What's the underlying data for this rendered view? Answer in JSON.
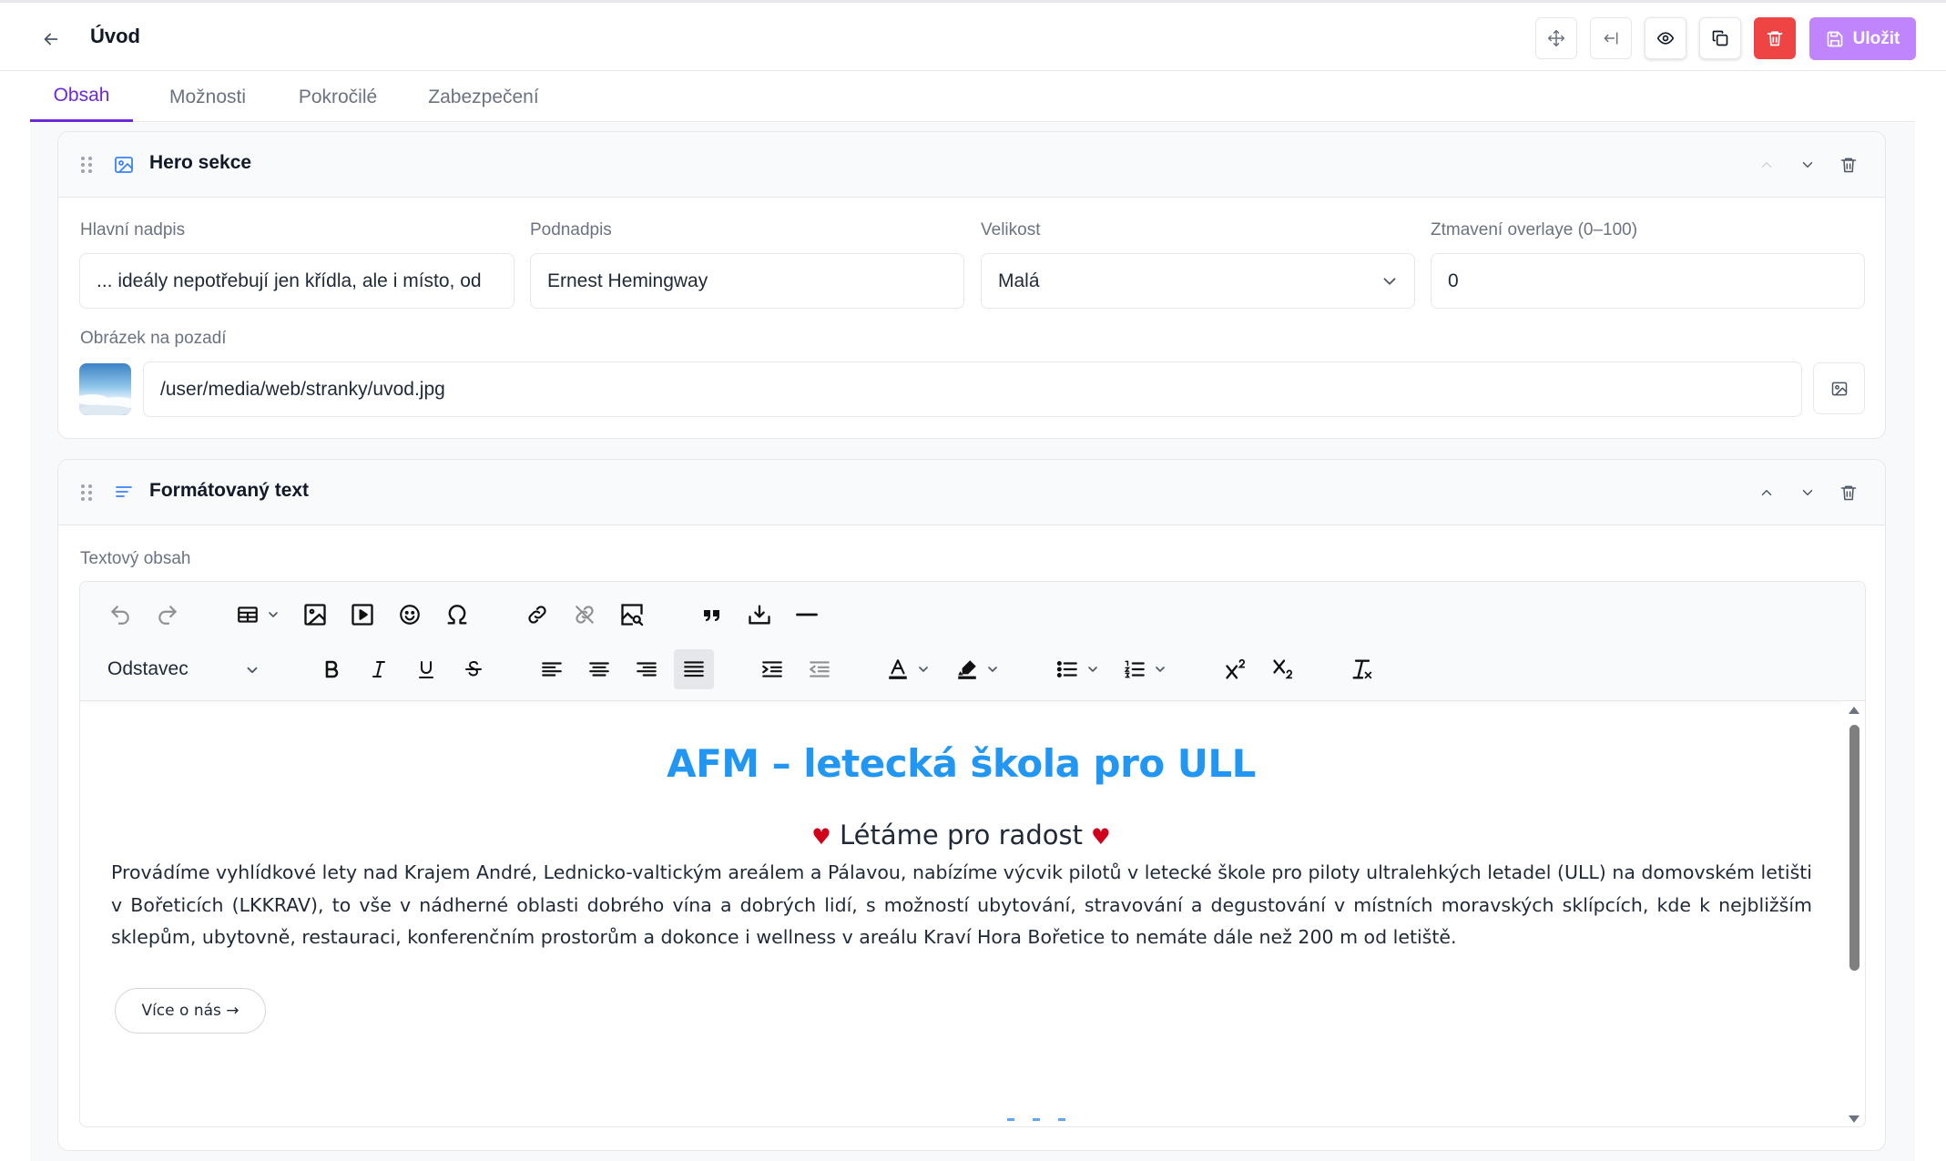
{
  "header": {
    "title": "Úvod",
    "save_label": "Uložit",
    "actions": [
      "move-icon",
      "collapse-left-icon",
      "eye-icon",
      "copy-icon",
      "trash-icon"
    ]
  },
  "tabs": [
    {
      "label": "Obsah",
      "active": true
    },
    {
      "label": "Možnosti",
      "active": false
    },
    {
      "label": "Pokročilé",
      "active": false
    },
    {
      "label": "Zabezpečení",
      "active": false
    }
  ],
  "colors": {
    "accent": "#6d28d9",
    "save": "#c084fc",
    "danger": "#ef4444",
    "heading_blue": "#2196f3",
    "heart_red": "#d0021b"
  },
  "hero": {
    "title": "Hero sekce",
    "fields": {
      "main_heading_label": "Hlavní nadpis",
      "main_heading_value": "... ideály nepotřebují jen křídla, ale i místo, od",
      "subtitle_label": "Podnadpis",
      "subtitle_value": "Ernest Hemingway",
      "size_label": "Velikost",
      "size_value": "Malá",
      "overlay_label": "Ztmavení overlaye (0–100)",
      "overlay_value": "0",
      "bg_label": "Obrázek na pozadí",
      "bg_value": "/user/media/web/stranky/uvod.jpg"
    }
  },
  "richtext": {
    "title": "Formátovaný text",
    "content_label": "Textový obsah",
    "format_select": "Odstavec",
    "doc": {
      "heading": "AFM – letecká škola pro ULL",
      "subheading": "Létáme pro radost",
      "heart": "♥",
      "paragraph": "Provádíme vyhlídkové lety nad Krajem André, Lednicko-valtickým areálem a Pálavou, nabízíme výcvik pilotů v letecké škole pro piloty ultralehkých letadel (ULL) na domovském letišti v Bořeticích (LKKRAV), to vše v nádherné oblasti dobrého vína a dobrých lidí, s možností ubytování, stravování a degustování v místních moravských sklípcích, kde k nejbližším sklepům, ubytovně, restauraci, konferenčním prostorům a dokonce i wellness v areálu Kraví Hora Bořetice to nemáte dále než 200 m od letiště.",
      "button": "Více o nás →"
    }
  }
}
